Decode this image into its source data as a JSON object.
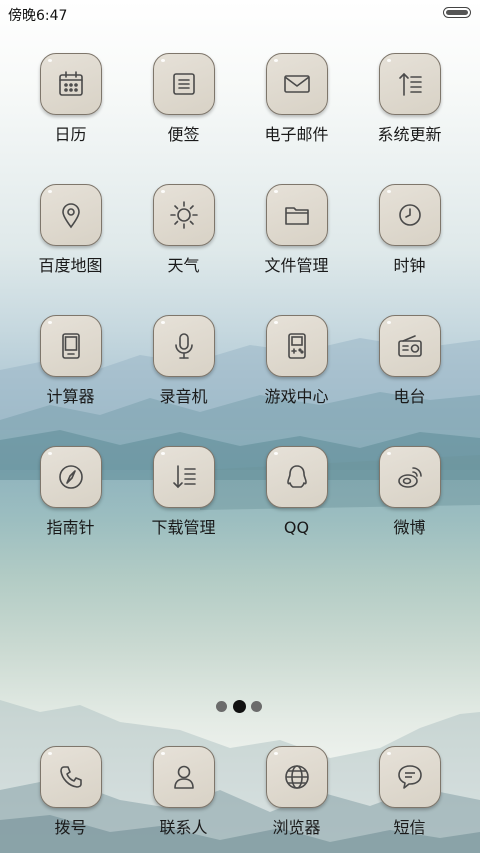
{
  "status_bar": {
    "time": "傍晚6:47"
  },
  "apps": [
    {
      "label": "日历",
      "icon": "calendar-icon"
    },
    {
      "label": "便签",
      "icon": "note-icon"
    },
    {
      "label": "电子邮件",
      "icon": "mail-icon"
    },
    {
      "label": "系统更新",
      "icon": "update-icon"
    },
    {
      "label": "百度地图",
      "icon": "map-pin-icon"
    },
    {
      "label": "天气",
      "icon": "sun-icon"
    },
    {
      "label": "文件管理",
      "icon": "folder-icon"
    },
    {
      "label": "时钟",
      "icon": "clock-icon"
    },
    {
      "label": "计算器",
      "icon": "calculator-icon"
    },
    {
      "label": "录音机",
      "icon": "microphone-icon"
    },
    {
      "label": "游戏中心",
      "icon": "gamepad-icon"
    },
    {
      "label": "电台",
      "icon": "radio-icon"
    },
    {
      "label": "指南针",
      "icon": "compass-icon"
    },
    {
      "label": "下载管理",
      "icon": "download-icon"
    },
    {
      "label": "QQ",
      "icon": "qq-icon"
    },
    {
      "label": "微博",
      "icon": "weibo-icon"
    }
  ],
  "page_indicator": {
    "count": 3,
    "active_index": 1
  },
  "dock": [
    {
      "label": "拨号",
      "icon": "phone-icon"
    },
    {
      "label": "联系人",
      "icon": "contacts-icon"
    },
    {
      "label": "浏览器",
      "icon": "globe-icon"
    },
    {
      "label": "短信",
      "icon": "message-icon"
    }
  ]
}
